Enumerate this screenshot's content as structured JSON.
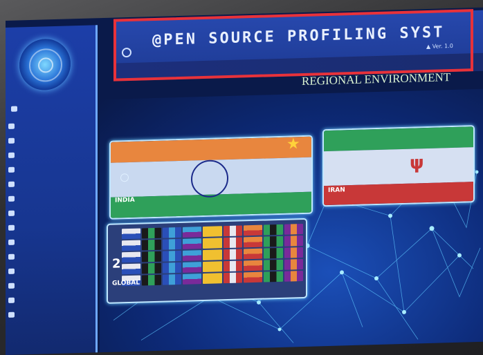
{
  "header": {
    "title": "@PEN SOURCE PROFILING SYST",
    "version": "▲ Ver. 1.0",
    "subtitle": "REGIONAL ENVIRONMENT"
  },
  "sidebar": {
    "home_label": "",
    "items": [
      {
        "label": "",
        "badge": null
      },
      {
        "label": "",
        "badge": null
      },
      {
        "label": "",
        "badge": ""
      },
      {
        "label": "",
        "badge": null
      },
      {
        "label": "",
        "badge": ""
      },
      {
        "label": "",
        "badge": null
      },
      {
        "label": "",
        "badge": null
      },
      {
        "label": "",
        "badge": null
      },
      {
        "label": "",
        "badge": null
      },
      {
        "label": "",
        "badge": null
      },
      {
        "label": "",
        "badge": null
      },
      {
        "label": "",
        "badge": null
      },
      {
        "label": "",
        "badge": null
      },
      {
        "label": "",
        "badge": null
      }
    ]
  },
  "main": {
    "section_label": "",
    "cards": {
      "india": {
        "name": "INDIA",
        "tag": "",
        "desc": ""
      },
      "iran": {
        "name": "IRAN",
        "desc": ""
      },
      "global": {
        "name": "GLOBAL",
        "num": "2",
        "desc": ""
      }
    }
  },
  "colors": {
    "accent": "#e8323a",
    "sidebar": "#1c3ea8",
    "header": "#2748ad",
    "glow": "#6fd0ff",
    "saffron": "#f08a3a",
    "green": "#2fa05a"
  },
  "icons": {
    "header_button": "circle-icon",
    "india_action": "add-icon",
    "india_badge": "star-icon"
  }
}
